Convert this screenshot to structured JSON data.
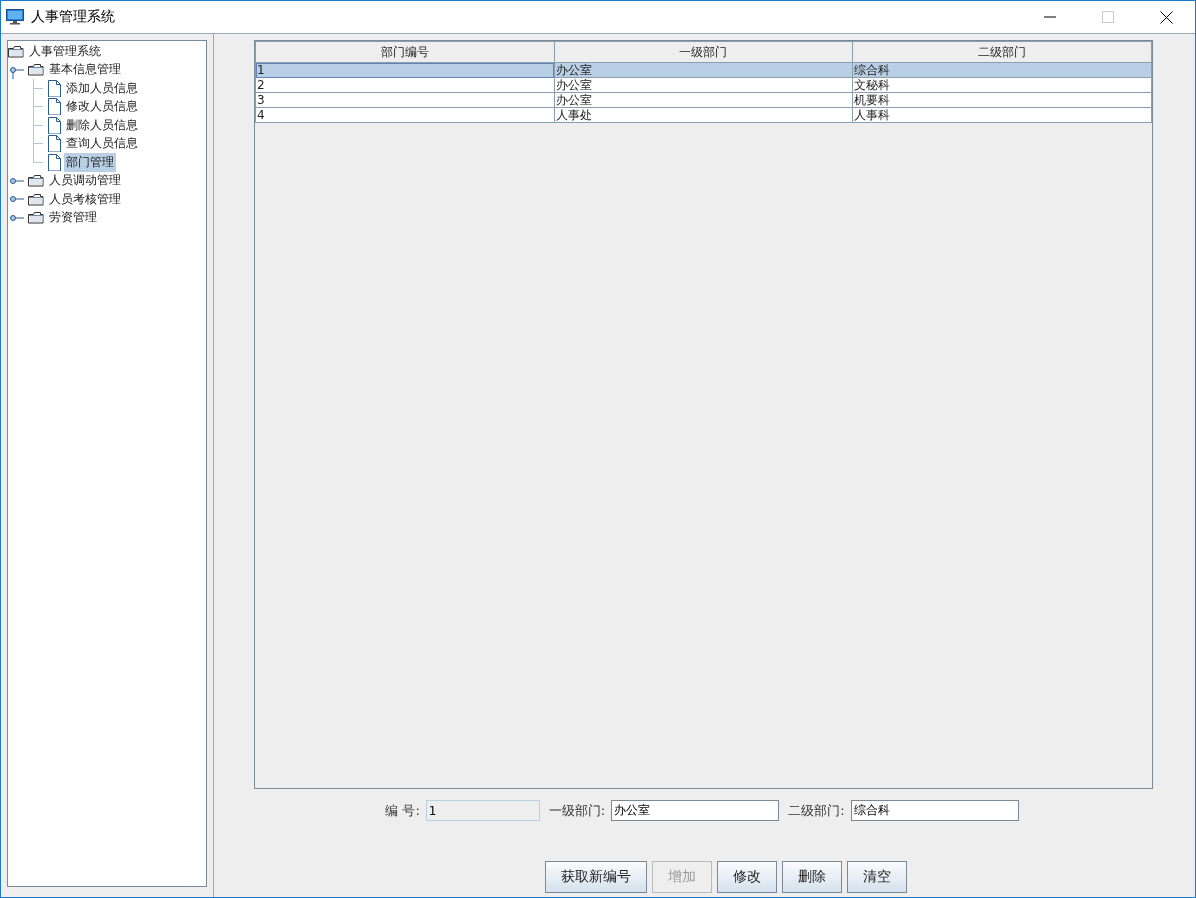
{
  "window": {
    "title": "人事管理系统"
  },
  "tree": {
    "label": "人事管理系统",
    "selected": false,
    "children": [
      {
        "label": "基本信息管理",
        "expanded": true,
        "selected": false,
        "children": [
          {
            "label": "添加人员信息",
            "selected": false
          },
          {
            "label": "修改人员信息",
            "selected": false
          },
          {
            "label": "删除人员信息",
            "selected": false
          },
          {
            "label": "查询人员信息",
            "selected": false
          },
          {
            "label": "部门管理",
            "selected": true
          }
        ]
      },
      {
        "label": "人员调动管理",
        "expanded": false,
        "selected": false
      },
      {
        "label": "人员考核管理",
        "expanded": false,
        "selected": false
      },
      {
        "label": "劳资管理",
        "expanded": false,
        "selected": false
      }
    ]
  },
  "table": {
    "columns": [
      "部门编号",
      "一级部门",
      "二级部门"
    ],
    "rows": [
      {
        "cells": [
          "1",
          "办公室",
          "综合科"
        ],
        "selected": true
      },
      {
        "cells": [
          "2",
          "办公室",
          "文秘科"
        ],
        "selected": false
      },
      {
        "cells": [
          "3",
          "办公室",
          "机要科"
        ],
        "selected": false
      },
      {
        "cells": [
          "4",
          "人事处",
          "人事科"
        ],
        "selected": false
      }
    ]
  },
  "form": [
    {
      "label": "编 号:",
      "value": "1",
      "disabled": true
    },
    {
      "label": "一级部门:",
      "value": "办公室",
      "disabled": false
    },
    {
      "label": "二级部门:",
      "value": "综合科",
      "disabled": false
    }
  ],
  "buttons": [
    {
      "label": "获取新编号",
      "disabled": false
    },
    {
      "label": "增加",
      "disabled": true
    },
    {
      "label": "修改",
      "disabled": false
    },
    {
      "label": "删除",
      "disabled": false
    },
    {
      "label": "清空",
      "disabled": false
    }
  ]
}
